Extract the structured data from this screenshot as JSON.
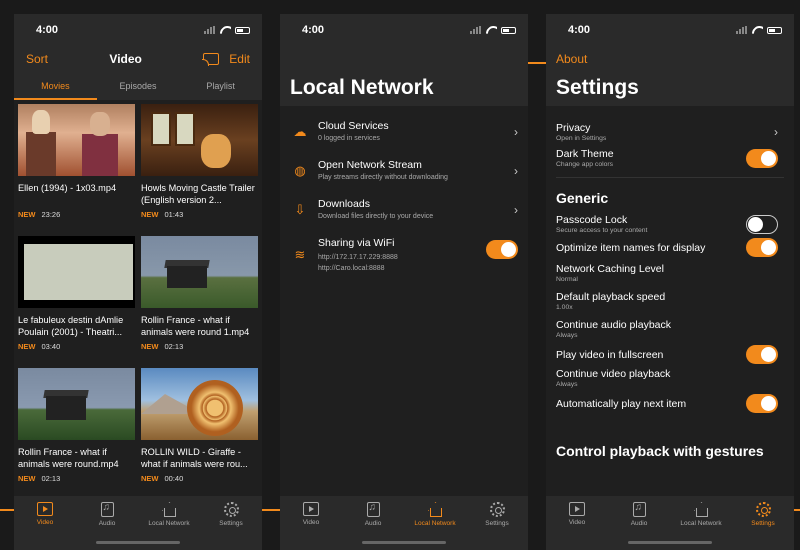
{
  "status_time": "4:00",
  "colors": {
    "accent": "#f28a1c",
    "background": "#1f1f1f",
    "bar": "#2a2a2a"
  },
  "video": {
    "nav": {
      "left": "Sort",
      "title": "Video",
      "right": "Edit"
    },
    "tabs": [
      "Movies",
      "Episodes",
      "Playlist"
    ],
    "items": [
      {
        "title": "Ellen (1994) - 1x03.mp4",
        "badge": "NEW",
        "duration": "23:26"
      },
      {
        "title": "Howls Moving Castle Trailer (English version 2...",
        "badge": "NEW",
        "duration": "01:43"
      },
      {
        "title": "Le fabuleux destin dAmlie Poulain (2001) - Theatri...",
        "badge": "NEW",
        "duration": "03:40"
      },
      {
        "title": "Rollin France - what if animals were round 1.mp4",
        "badge": "NEW",
        "duration": "02:13"
      },
      {
        "title": "Rollin France - what if animals were round.mp4",
        "badge": "NEW",
        "duration": "02:13"
      },
      {
        "title": "ROLLIN WILD - Giraffe - what if animals were rou...",
        "badge": "NEW",
        "duration": "00:40"
      }
    ]
  },
  "tabbar": [
    "Video",
    "Audio",
    "Local Network",
    "Settings"
  ],
  "network": {
    "title": "Local Network",
    "rows": [
      {
        "title": "Cloud Services",
        "sub": "0 logged in services",
        "icon": "cloud-icon"
      },
      {
        "title": "Open Network Stream",
        "sub": "Play streams directly without downloading",
        "icon": "globe-icon"
      },
      {
        "title": "Downloads",
        "sub": "Download files directly to your device",
        "icon": "download-icon"
      }
    ],
    "sharing": {
      "title": "Sharing via WiFi",
      "url1": "http://172.17.17.229:8888",
      "url2": "http://Caro.local:8888",
      "enabled": true
    }
  },
  "settings": {
    "nav_left": "About",
    "title": "Settings",
    "privacy": {
      "title": "Privacy",
      "sub": "Open in Settings"
    },
    "dark_theme": {
      "title": "Dark Theme",
      "sub": "Change app colors",
      "enabled": true
    },
    "section_generic": "Generic",
    "passcode": {
      "title": "Passcode Lock",
      "sub": "Secure access to your content",
      "enabled": false
    },
    "optimize": {
      "title": "Optimize item names for display",
      "enabled": true
    },
    "caching": {
      "title": "Network Caching Level",
      "sub": "Normal"
    },
    "speed": {
      "title": "Default playback speed",
      "sub": "1.00x"
    },
    "audio_continue": {
      "title": "Continue audio playback",
      "sub": "Always"
    },
    "fullscreen": {
      "title": "Play video in fullscreen",
      "enabled": true
    },
    "video_continue": {
      "title": "Continue video playback",
      "sub": "Always"
    },
    "autoplay": {
      "title": "Automatically play next item",
      "enabled": true
    },
    "section_gestures": "Control playback with gestures"
  }
}
